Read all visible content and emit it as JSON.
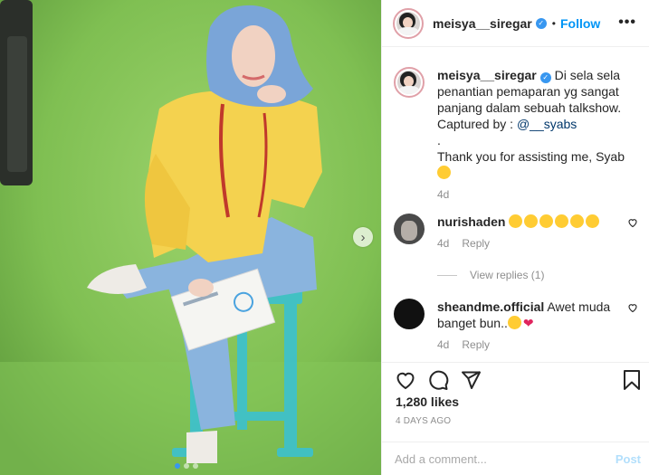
{
  "post": {
    "username": "meisya__siregar",
    "bullet": "•",
    "follow_label": "Follow",
    "more_label": "•••",
    "caption": {
      "username": "meisya__siregar",
      "text": "Di sela sela penantian pemaparan yg sangat panjang dalam sebuah talkshow. Captured by :",
      "mention": "@__syabs",
      "dot": ".",
      "thanks": "Thank you for assisting me, Syab",
      "time": "4d"
    },
    "comments": [
      {
        "username": "nurishaden",
        "text": "",
        "emojis": [
          "heart-eyes",
          "heart-eyes",
          "heart-eyes",
          "heart-eyes",
          "heart-eyes",
          "heart-eyes"
        ],
        "time": "4d",
        "reply_label": "Reply"
      },
      {
        "username": "sheandme.official",
        "text": "Awet muda banget bun..",
        "emojis": [
          "smile",
          "red-heart"
        ],
        "time": "4d",
        "reply_label": "Reply"
      }
    ],
    "view_replies": "View replies (1)",
    "likes": "1,280 likes",
    "date": "4 DAYS AGO",
    "add_comment_placeholder": "Add a comment...",
    "post_label": "Post"
  },
  "carousel": {
    "total": 3,
    "active": 1,
    "next_icon": "›"
  },
  "icons": [
    "verified-badge-icon",
    "more-options-icon",
    "heart-icon",
    "comment-icon",
    "share-icon",
    "bookmark-icon",
    "next-arrow-icon"
  ],
  "colors": {
    "accent": "#0095f6",
    "green_screen": "#7fbf52",
    "hijab": "#7aa5d8",
    "blouse": "#f4d24f",
    "pants": "#8ab4de",
    "stool": "#3fc1c9"
  }
}
